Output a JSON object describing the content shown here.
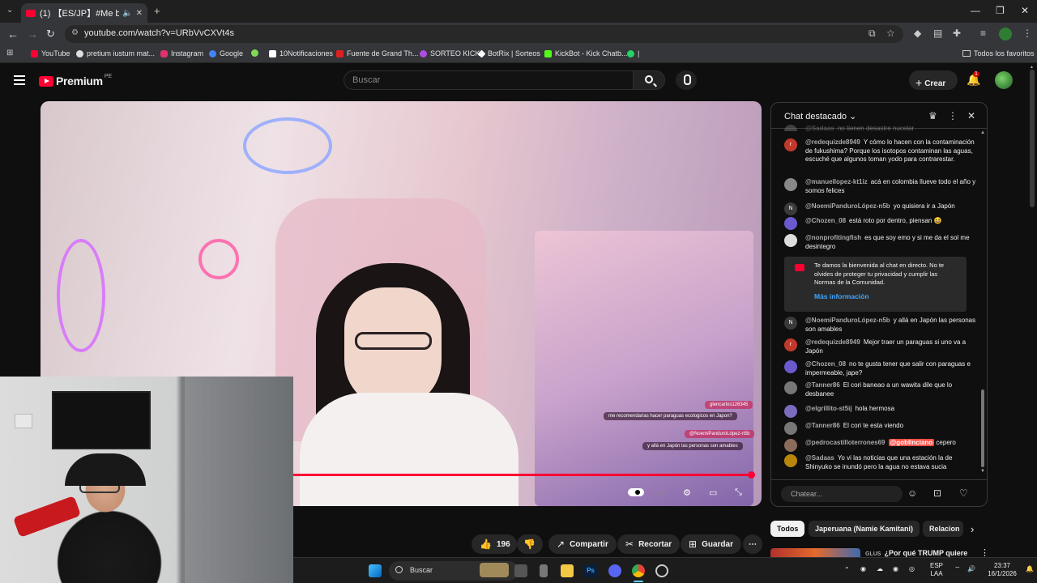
{
  "browser": {
    "tab_title": "(1) 【ES/JP】#Me bañe - You",
    "url": "youtube.com/watch?v=URbVvCXVt4s",
    "bookmarks": [
      {
        "label": "YouTube",
        "color": "#ff0033"
      },
      {
        "label": "pretium iustum mat...",
        "color": "#e0e0e0"
      },
      {
        "label": "Instagram",
        "color": "#e1306c"
      },
      {
        "label": "Google",
        "color": "#4285f4"
      },
      {
        "label": "",
        "color": "#7ed957"
      },
      {
        "label": "10Notificaciones",
        "color": "#ffffff"
      },
      {
        "label": "Fuente de Grand Th...",
        "color": "#e02020"
      },
      {
        "label": "SORTEO KICK",
        "color": "#b04be0"
      },
      {
        "label": "BotRix | Sorteos",
        "color": "#ffffff"
      },
      {
        "label": "KickBot - Kick Chatb...",
        "color": "#53fc18"
      },
      {
        "label": "|",
        "color": "#25d366"
      }
    ],
    "all_bookmarks": "Todos los favoritos"
  },
  "yt": {
    "logo_word": "Premium",
    "country": "PE",
    "search_placeholder": "Buscar",
    "create_label": "Crear",
    "notif_count": "1"
  },
  "video": {
    "overlay_comments": [
      "glencarlos126345",
      "me recomendarias hacer paraguas ecologicos en Japon?",
      "@NoemiPanduroLópez-n5b",
      "y allá en Japón las personas son amables"
    ],
    "progress": 0.99
  },
  "actions": {
    "likes": "196",
    "share": "Compartir",
    "clip": "Recortar",
    "save": "Guardar"
  },
  "chat": {
    "title": "Chat destacado",
    "input_placeholder": "Chatear...",
    "messages": [
      {
        "user": "@Sadaas",
        "text": "no tienen desastre nucelar",
        "initial": "",
        "color": "#888888"
      },
      {
        "user": "@redequizde8949",
        "text": "Y cómo lo hacen con la contaminación de fukushima? Porque los isotopos contaminan las aguas, escuché que algunos toman yodo para contrarestar.",
        "initial": "r",
        "color": "#c0392b"
      },
      {
        "user": "@manuellopez-kt1iz",
        "text": "acá en colombia llueve todo el año y somos felices",
        "initial": "",
        "color": "#888888"
      },
      {
        "user": "@NoemiPanduroLópez-n5b",
        "text": "yo quisiera ir a Japón",
        "initial": "N",
        "color": "#3a3a3a"
      },
      {
        "user": "@Chozen_08",
        "text": "está roto por dentro, piensan 😆",
        "initial": "",
        "color": "#6a5acd"
      },
      {
        "user": "@nonprofitingfish",
        "text": "es que soy emo y si me da el sol me desintegro",
        "initial": "",
        "color": "#dddddd"
      },
      {
        "user": "@NoemiPanduroLópez-n5b",
        "text": "y allá en Japón las personas son amables",
        "initial": "N",
        "color": "#3a3a3a"
      },
      {
        "user": "@redequizde8949",
        "text": "Mejor traer un paraguas si uno va a Japón",
        "initial": "r",
        "color": "#c0392b"
      },
      {
        "user": "@Chozen_08",
        "text": "no te gusta tener que salir con paraguas e impermeable, jape?",
        "initial": "",
        "color": "#6a5acd"
      },
      {
        "user": "@Tanner86",
        "text": "El cori baneao a un wawita dile que lo desbanee",
        "initial": "",
        "color": "#777777"
      },
      {
        "user": "@elgrillito-st5ij",
        "text": "hola hermosa",
        "initial": "",
        "color": "#7d6bbf"
      },
      {
        "user": "@Tanner86",
        "text": "El cori te esta viendo",
        "initial": "",
        "color": "#777777"
      },
      {
        "user": "@pedrocastilloterrones69",
        "mention": "@goblinciano",
        "text": "cepero",
        "initial": "",
        "color": "#8b6b5a"
      },
      {
        "user": "@Sadaas",
        "text": "Yo vi las noticias que una estación la de Shinyuko se inundó pero la agua no estava sucia",
        "initial": "",
        "color": "#b8860b"
      }
    ],
    "welcome": {
      "text": "Te damos la bienvenida al chat en directo. No te olvides de proteger tu privacidad y cumplir las Normas de la Comunidad.",
      "more": "Más información"
    }
  },
  "chips": [
    "Todos",
    "Japeruana (Namie Kamitani)",
    "Relacion"
  ],
  "related": {
    "channel": "GLUS",
    "title": "¿Por qué TRUMP quiere"
  },
  "taskbar": {
    "search": "Buscar",
    "lang": "ESP",
    "layout": "LAA",
    "time": "23:37",
    "date": "16/1/2026"
  }
}
